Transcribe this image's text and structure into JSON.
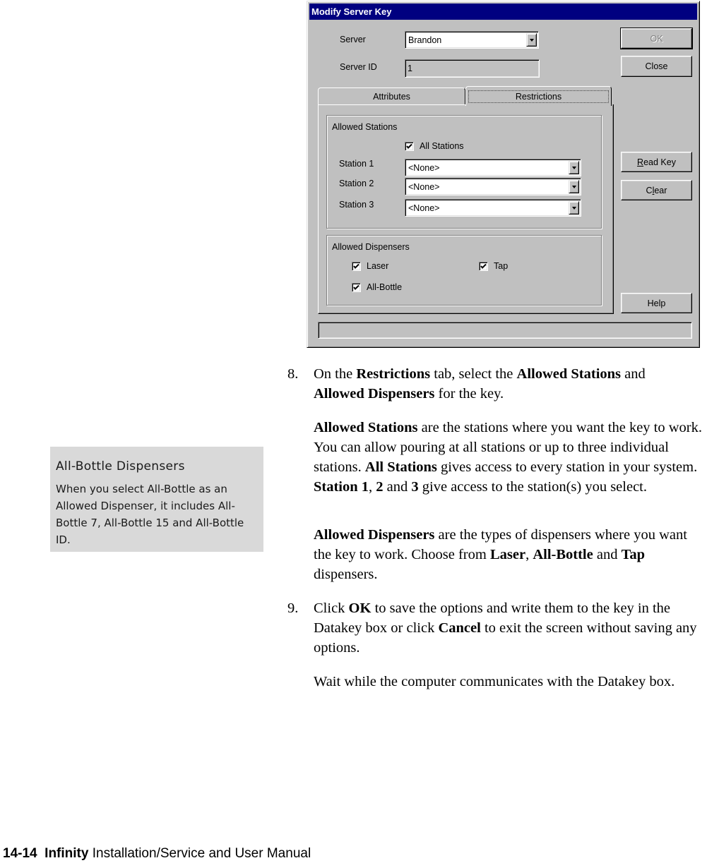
{
  "dialog": {
    "title": "Modify Server Key",
    "server_label": "Server",
    "server_value": "Brandon",
    "server_id_label": "Server ID",
    "server_id_value": "1",
    "buttons": {
      "ok": "OK",
      "close": "Close",
      "read_key_mnemonic": "R",
      "read_key_rest": "ead Key",
      "clear_pre": "C",
      "clear_mnemonic": "l",
      "clear_post": "ear",
      "help": "Help"
    },
    "ok_enabled": false,
    "tabs": [
      {
        "label": "Attributes",
        "selected": false
      },
      {
        "label": "Restrictions",
        "selected": true
      }
    ],
    "allowed_stations": {
      "legend": "Allowed Stations",
      "all_stations_label": "All Stations",
      "all_stations_checked": true,
      "stations": [
        {
          "label": "Station 1",
          "value": "<None>"
        },
        {
          "label": "Station 2",
          "value": "<None>"
        },
        {
          "label": "Station 3",
          "value": "<None>"
        }
      ]
    },
    "allowed_dispensers": {
      "legend": "Allowed Dispensers",
      "items": [
        {
          "label": "Laser",
          "checked": true
        },
        {
          "label": "Tap",
          "checked": true
        },
        {
          "label": "All-Bottle",
          "checked": true
        }
      ]
    },
    "status_text": ""
  },
  "note": {
    "title": "All-Bottle Dispensers",
    "body": "When you select All-Bottle as an Allowed Dispenser, it includes All-Bottle 7, All-Bottle 15 and All-Bottle ID."
  },
  "steps": {
    "s8": {
      "number": "8.",
      "t1": "On the ",
      "b1": "Restrictions",
      "t2": " tab, select the ",
      "b2": "Allowed Stations",
      "t3": " and ",
      "b3": "Allowed Dispensers",
      "t4": " for the key."
    },
    "p_stations": {
      "b1": "Allowed Stations",
      "t1": " are the stations where you want the key to work. You can allow pouring at all stations or up to three individual stations. ",
      "b2": "All Stations",
      "t2": " gives access to every station in your system. ",
      "b3": "Station 1",
      "t3": ", ",
      "b4": "2",
      "t4": " and ",
      "b5": "3",
      "t5": " give access to the station(s) you select."
    },
    "p_dispensers": {
      "b1": "Allowed Dispensers",
      "t1": " are the types of dispensers where you want the key to work. Choose from ",
      "b2": "Laser",
      "t2": ", ",
      "b3": "All-Bottle",
      "t3": " and ",
      "b4": "Tap",
      "t4": " dispensers."
    },
    "s9": {
      "number": "9.",
      "t1": "Click ",
      "b1": "OK",
      "t2": " to save the options and write them to the key in the Datakey box or click ",
      "b2": "Cancel",
      "t3": " to exit the screen without saving any options."
    },
    "p_wait": "Wait while the computer communicates with the Datakey box."
  },
  "footer": {
    "page": "14-14",
    "product": "Infinity",
    "title": "Installation/Service and User Manual"
  }
}
